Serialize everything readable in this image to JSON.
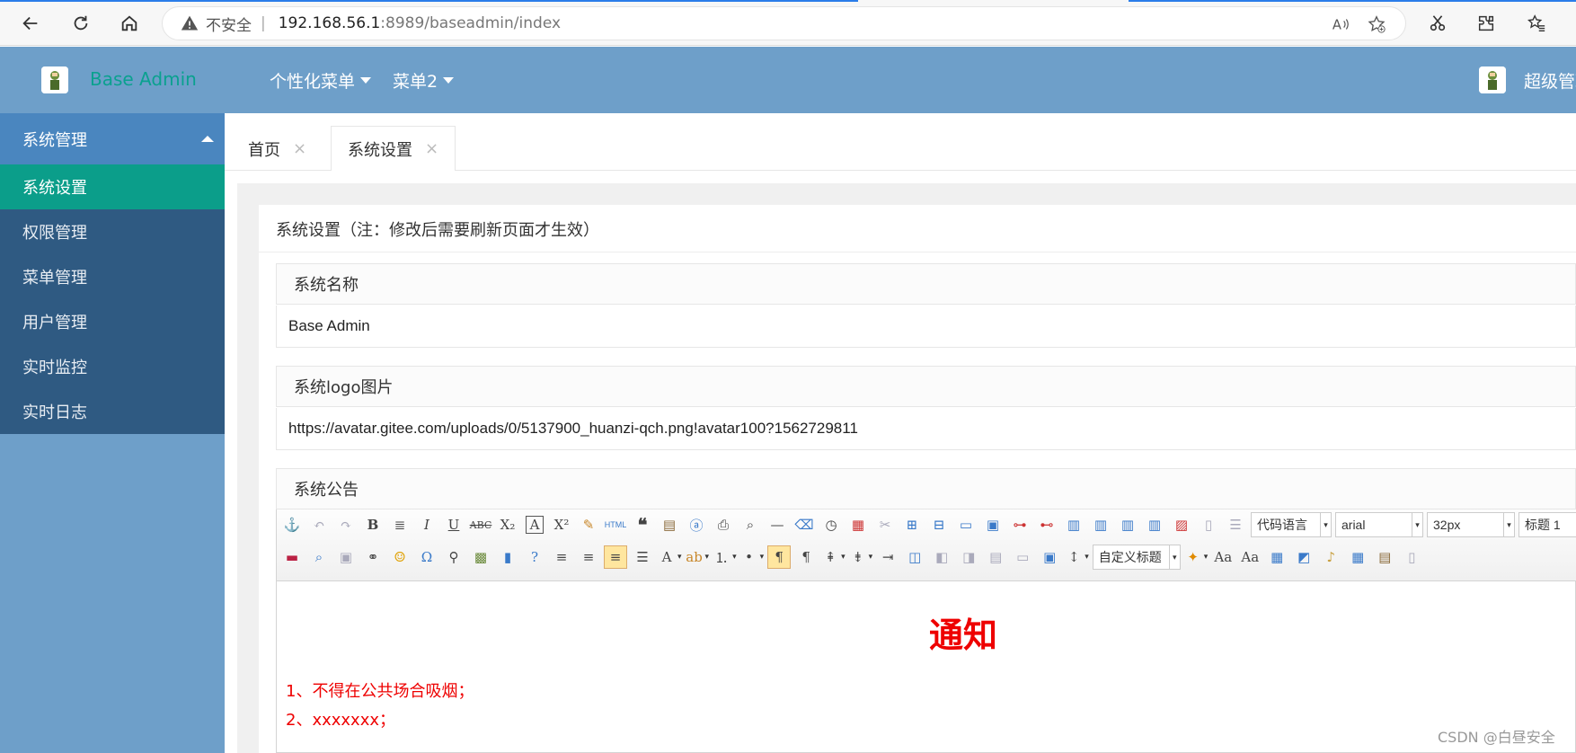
{
  "browser": {
    "insecure_label": "不安全",
    "separator": "|",
    "url_host": "192.168.56.1",
    "url_rest": ":8989/baseadmin/index"
  },
  "header": {
    "brand": "Base Admin",
    "menus": [
      "个性化菜单",
      "菜单2"
    ],
    "user_name": "超级管理员"
  },
  "sidebar": {
    "group_label": "系统管理",
    "items": [
      {
        "label": "系统设置",
        "active": true
      },
      {
        "label": "权限管理",
        "active": false
      },
      {
        "label": "菜单管理",
        "active": false
      },
      {
        "label": "用户管理",
        "active": false
      },
      {
        "label": "实时监控",
        "active": false
      },
      {
        "label": "实时日志",
        "active": false
      }
    ]
  },
  "tabs": [
    {
      "label": "首页",
      "close": "×"
    },
    {
      "label": "系统设置",
      "close": "×"
    }
  ],
  "card": {
    "title": "系统设置（注：修改后需要刷新页面才生效）"
  },
  "fields": {
    "sys_name_label": "系统名称",
    "sys_name_value": "Base Admin",
    "logo_label": "系统logo图片",
    "logo_value": "https://avatar.gitee.com/uploads/0/5137900_huanzi-qch.png!avatar100?1562729811",
    "notice_label": "系统公告"
  },
  "editor": {
    "code_lang": "代码语言",
    "font_family": "arial",
    "font_size": "32px",
    "heading": "标题 1",
    "custom_title": "自定义标题",
    "content_title": "通知",
    "content_lines": [
      "1、不得在公共场合吸烟；",
      "2、xxxxxxx；"
    ]
  },
  "watermark": "CSDN @白昼安全",
  "colors": {
    "header_bg": "#6e9fc9",
    "brand": "#0aa18f",
    "active_item": "#0b9e8a",
    "sidebar_item_bg": "#2f5a82",
    "notice_red": "#e00"
  }
}
